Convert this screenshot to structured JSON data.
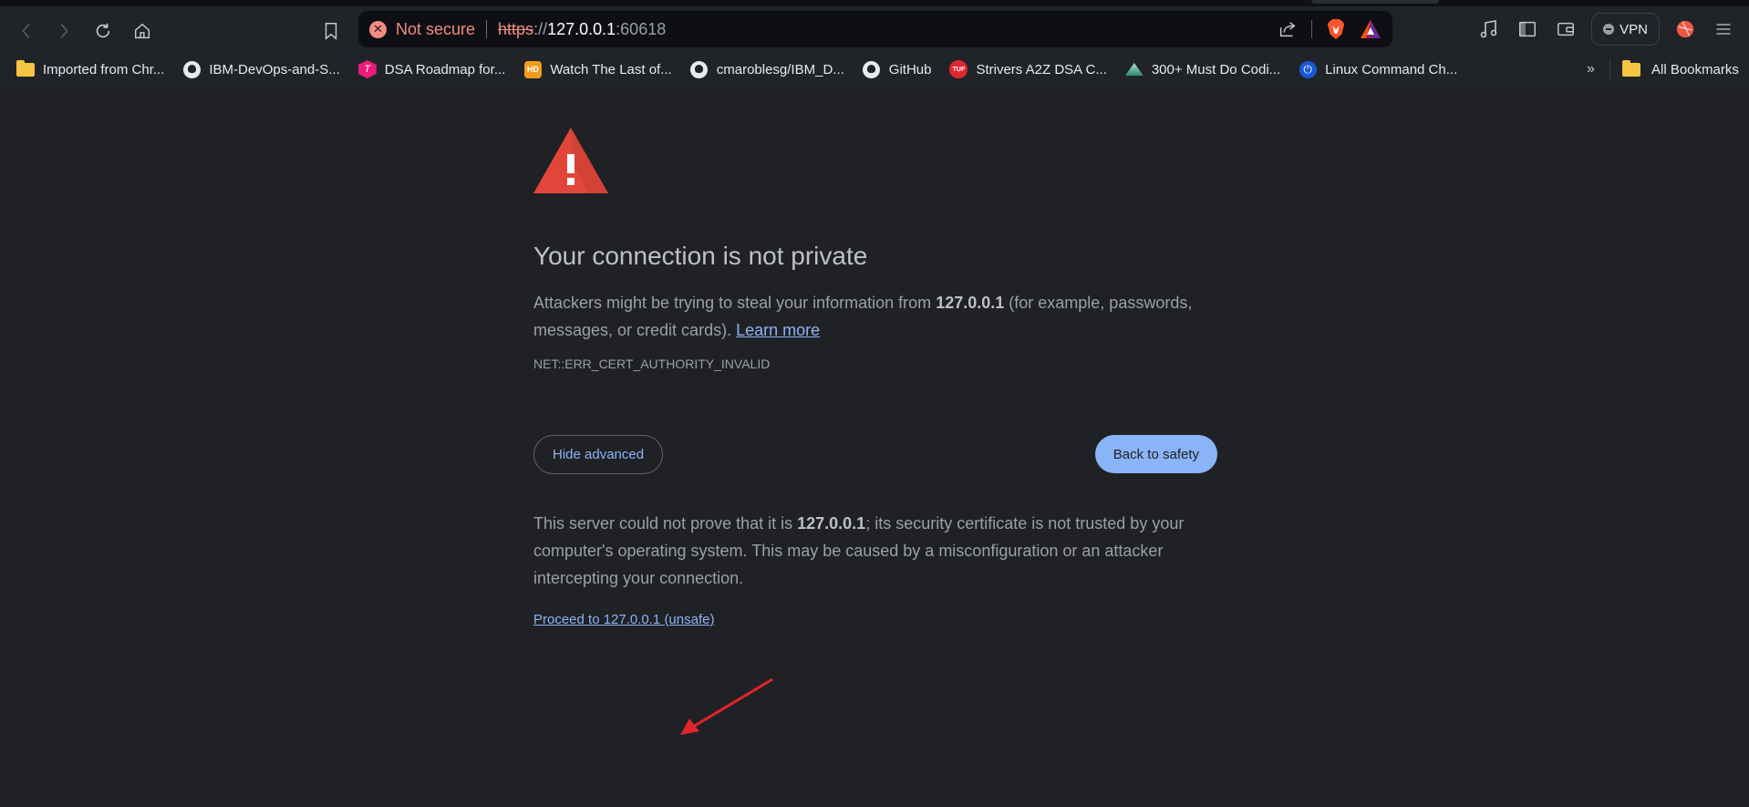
{
  "browser": {
    "nav": {
      "back_icon": "chevron-left-icon",
      "forward_icon": "chevron-right-icon",
      "reload_icon": "reload-icon",
      "home_icon": "home-icon",
      "bookmark_icon": "bookmark-icon"
    },
    "omnibox": {
      "security_label": "Not secure",
      "url_scheme": "https",
      "url_slashes": "://",
      "url_host": "127.0.0.1",
      "url_port": ":60618"
    },
    "right_tools": {
      "vpn_label": "VPN"
    },
    "bookmarks": [
      {
        "label": "Imported from Chr...",
        "icon": "folder"
      },
      {
        "label": "IBM-DevOps-and-S...",
        "icon": "github"
      },
      {
        "label": "DSA Roadmap for...",
        "icon": "dsa"
      },
      {
        "label": "Watch The Last of...",
        "icon": "hd"
      },
      {
        "label": "cmaroblesg/IBM_D...",
        "icon": "github"
      },
      {
        "label": "GitHub",
        "icon": "github"
      },
      {
        "label": "Strivers A2Z DSA C...",
        "icon": "tuf"
      },
      {
        "label": "300+ Must Do Codi...",
        "icon": "mountain"
      },
      {
        "label": "Linux Command Ch...",
        "icon": "linux"
      }
    ],
    "bookmarks_overflow": "»",
    "all_bookmarks_label": "All Bookmarks",
    "icon_text": {
      "hd": "HD",
      "tuf": "TUF",
      "dsa": "T",
      "sec_x": "✕"
    }
  },
  "interstitial": {
    "heading": "Your connection is not private",
    "explain_pre": "Attackers might be trying to steal your information from ",
    "explain_host": "127.0.0.1",
    "explain_post": " (for example, passwords, messages, or credit cards). ",
    "learn_more": "Learn more",
    "error_code": "NET::ERR_CERT_AUTHORITY_INVALID",
    "hide_advanced": "Hide advanced",
    "back_to_safety": "Back to safety",
    "details_pre": "This server could not prove that it is ",
    "details_host": "127.0.0.1",
    "details_post": "; its security certificate is not trusted by your computer's operating system. This may be caused by a misconfiguration or an attacker intercepting your connection.",
    "proceed_link": "Proceed to 127.0.0.1 (unsafe)"
  },
  "colors": {
    "page_bg": "#202124",
    "accent_blue": "#8ab4f8",
    "warning_red": "#e2463a",
    "insecure_red": "#f28b82"
  }
}
